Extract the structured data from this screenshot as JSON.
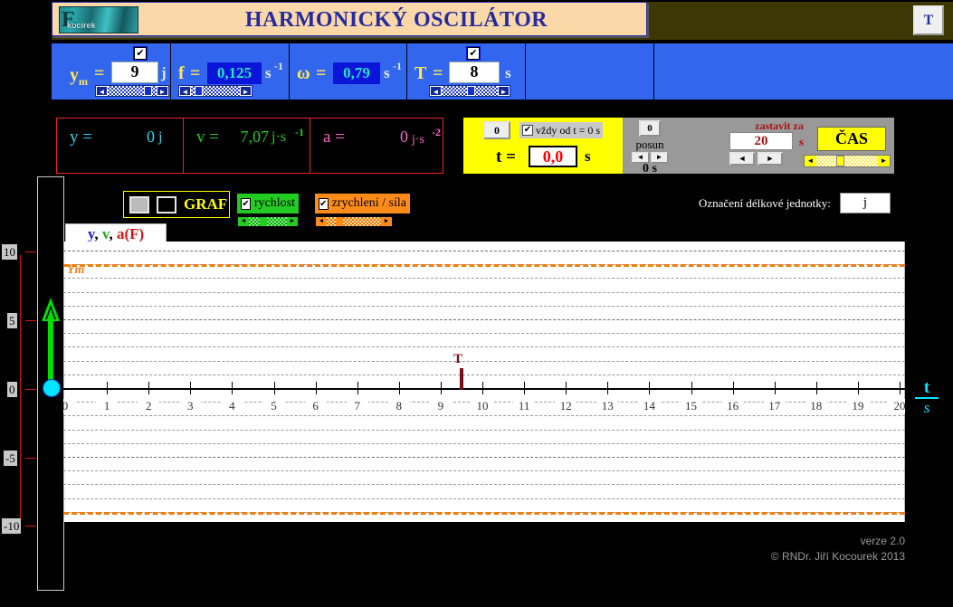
{
  "header": {
    "title": "HARMONICKÝ OSCILÁTOR",
    "logo_text": "kocirek",
    "logo_initial": "E",
    "t_button": "T"
  },
  "parameters": [
    {
      "symbol": "y",
      "subscript": "m",
      "eq": "=",
      "value": "9",
      "unit": "j",
      "sup": "",
      "checkbox": "✔",
      "has_checkbox": true,
      "field_style": "white"
    },
    {
      "symbol": "f",
      "subscript": "",
      "eq": "=",
      "value": "0,125",
      "unit": "s",
      "sup": "-1",
      "checkbox": "",
      "has_checkbox": false,
      "field_style": "blue"
    },
    {
      "symbol": "ω",
      "subscript": "",
      "eq": "=",
      "value": "0,79",
      "unit": "s",
      "sup": "-1",
      "checkbox": "",
      "has_checkbox": false,
      "field_style": "blue"
    },
    {
      "symbol": "T",
      "subscript": "",
      "eq": "=",
      "value": "8",
      "unit": "s",
      "sup": "",
      "checkbox": "✔",
      "has_checkbox": true,
      "field_style": "white"
    }
  ],
  "values": [
    {
      "label": "y =",
      "value": "0",
      "unit": "j",
      "sup": "",
      "color": "#2ad8f0"
    },
    {
      "label": "v =",
      "value": "7,07",
      "unit": "j·s",
      "sup": "-1",
      "color": "#22cc22"
    },
    {
      "label": "a =",
      "value": "0",
      "unit": "j·s",
      "sup": "-2",
      "color": "#ff66cc"
    }
  ],
  "time_panel": {
    "zero_button": "0",
    "always_from_zero_label": "vždy od t = 0 s",
    "always_from_zero_checked": "✔",
    "t_label": "t =",
    "t_value": "0,0",
    "t_unit": "s"
  },
  "posun_panel": {
    "number": "0",
    "label": "posun",
    "left_arrow": "◄",
    "right_arrow": "►",
    "value": "0 s"
  },
  "stop_panel": {
    "title": "zastavit za",
    "value": "20",
    "unit": "s",
    "left_arrow": "◄",
    "right_arrow": "►",
    "cas_button": "ČAS"
  },
  "options": {
    "graf_label": "GRAF",
    "rychlost_label": "rychlost",
    "rychlost_checked": "✔",
    "rychlost_color": "#22cc22",
    "zrychleni_label": "zrychlení / síla",
    "zrychleni_checked": "✔",
    "zrychleni_color": "#ff8c1a",
    "unit_designation_label": "Označení délkové jednotky:",
    "unit_designation_value": "j"
  },
  "ruler": {
    "labels": [
      "10",
      "5",
      "0",
      "-5",
      "-10"
    ]
  },
  "graph": {
    "title_parts": [
      {
        "text": "y",
        "color": "#2222cc"
      },
      {
        "text": ", ",
        "color": "#000000"
      },
      {
        "text": "v",
        "color": "#22aa22"
      },
      {
        "text": ", ",
        "color": "#000000"
      },
      {
        "text": "a(F)",
        "color": "#dd1111"
      }
    ],
    "ym_label": "Ym",
    "period_marker_label": "T",
    "axis_label_num": "t",
    "axis_label_den": "s"
  },
  "chart_data": {
    "type": "line",
    "title": "y, v, a(F)",
    "xlabel": "t / s",
    "ylabel": "y, v, a(F)",
    "xlim": [
      0,
      20
    ],
    "x_ticks": [
      "0",
      "1",
      "2",
      "3",
      "4",
      "5",
      "6",
      "7",
      "8",
      "9",
      "10",
      "11",
      "12",
      "13",
      "14",
      "15",
      "16",
      "17",
      "18",
      "19",
      "20"
    ],
    "ylim": [
      -9,
      9
    ],
    "amplitude_lines": [
      9,
      -9
    ],
    "grid": true,
    "annotations": [
      {
        "label": "Ym",
        "y": 9,
        "color": "#f07f10"
      },
      {
        "label": "T",
        "x": 8,
        "color": "#7a0d15"
      }
    ],
    "series": [
      {
        "name": "y",
        "color": "#2222cc",
        "values": []
      },
      {
        "name": "v",
        "color": "#22aa22",
        "values": []
      },
      {
        "name": "a(F)",
        "color": "#dd1111",
        "values": []
      }
    ]
  },
  "footer": {
    "version": "verze 2.0",
    "copyright": "© RNDr. Jiří Kocourek  2013"
  }
}
